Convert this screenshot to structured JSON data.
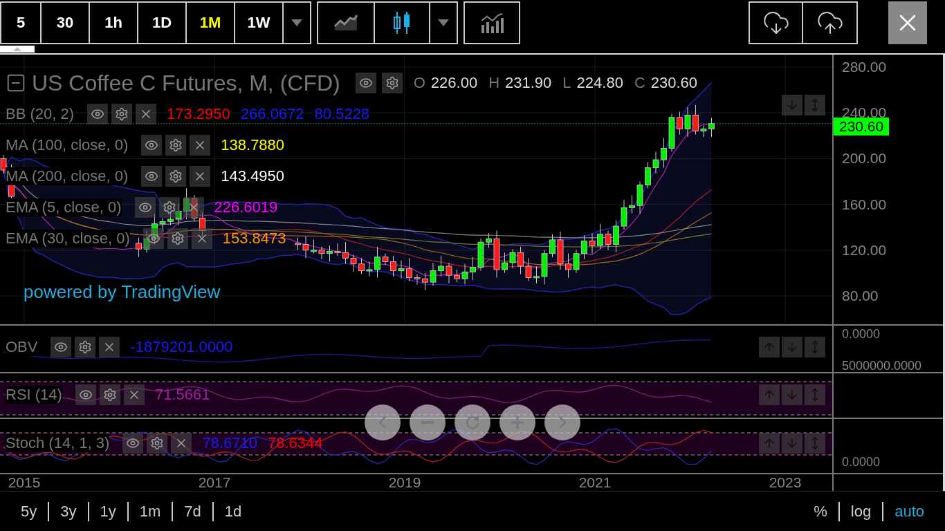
{
  "toolbar": {
    "intervals": [
      {
        "label": "5",
        "selected": false
      },
      {
        "label": "30",
        "selected": false
      },
      {
        "label": "1h",
        "selected": false
      },
      {
        "label": "1D",
        "selected": false
      },
      {
        "label": "1M",
        "selected": true
      },
      {
        "label": "1W",
        "selected": false
      }
    ],
    "chart_types": [
      {
        "kind": "area",
        "selected": false
      },
      {
        "kind": "candles",
        "selected": true
      }
    ]
  },
  "main_pane": {
    "title": "US Coffee C Futures, M, (CFD)",
    "ohlc": [
      {
        "label": "O",
        "value": "226.00"
      },
      {
        "label": "H",
        "value": "231.90"
      },
      {
        "label": "L",
        "value": "224.80"
      },
      {
        "label": "C",
        "value": "230.60"
      }
    ],
    "indicators": [
      {
        "name": "BB (20, 2)",
        "values": [
          {
            "text": "173.2950",
            "color": "#ff0000"
          },
          {
            "text": "266.0672",
            "color": "#1a1aff"
          },
          {
            "text": "80.5228",
            "color": "#1a1aff"
          }
        ]
      },
      {
        "name": "MA (100, close, 0)",
        "values": [
          {
            "text": "138.7880",
            "color": "#ffff00"
          }
        ]
      },
      {
        "name": "MA (200, close, 0)",
        "values": [
          {
            "text": "143.4950",
            "color": "#ffffff"
          }
        ]
      },
      {
        "name": "EMA (5, close, 0)",
        "values": [
          {
            "text": "226.6019",
            "color": "#ff00ff"
          }
        ]
      },
      {
        "name": "EMA (30, close, 0)",
        "values": [
          {
            "text": "153.8473",
            "color": "#ff9900"
          }
        ]
      }
    ],
    "branding": "powered by TradingView",
    "price_ticks": [
      "280.00",
      "240.00",
      "200.00",
      "160.00",
      "120.00",
      "80.00"
    ],
    "last_price": "230.60"
  },
  "sub_panes": [
    {
      "kind": "obv",
      "name": "OBV",
      "values": [
        {
          "text": "-1879201.0000",
          "color": "#1a1aff"
        }
      ],
      "ticks": [
        "0.0000",
        "5000000.0000"
      ]
    },
    {
      "kind": "rsi",
      "name": "RSI (14)",
      "values": [
        {
          "text": "71.5661",
          "color": "#a020a0"
        }
      ]
    },
    {
      "kind": "stoch",
      "name": "Stoch (14, 1, 3)",
      "values": [
        {
          "text": "78.6710",
          "color": "#1a1aff"
        },
        {
          "text": "78.6344",
          "color": "#ff0000"
        }
      ],
      "ticks": [
        "0.0000"
      ]
    }
  ],
  "time_axis": [
    "2015",
    "2017",
    "2019",
    "2021",
    "2023"
  ],
  "ranges": [
    "5y",
    "3y",
    "1y",
    "1m",
    "7d",
    "1d"
  ],
  "scale_options": [
    {
      "label": "%",
      "selected": false
    },
    {
      "label": "log",
      "selected": false
    },
    {
      "label": "auto",
      "selected": true
    }
  ]
}
